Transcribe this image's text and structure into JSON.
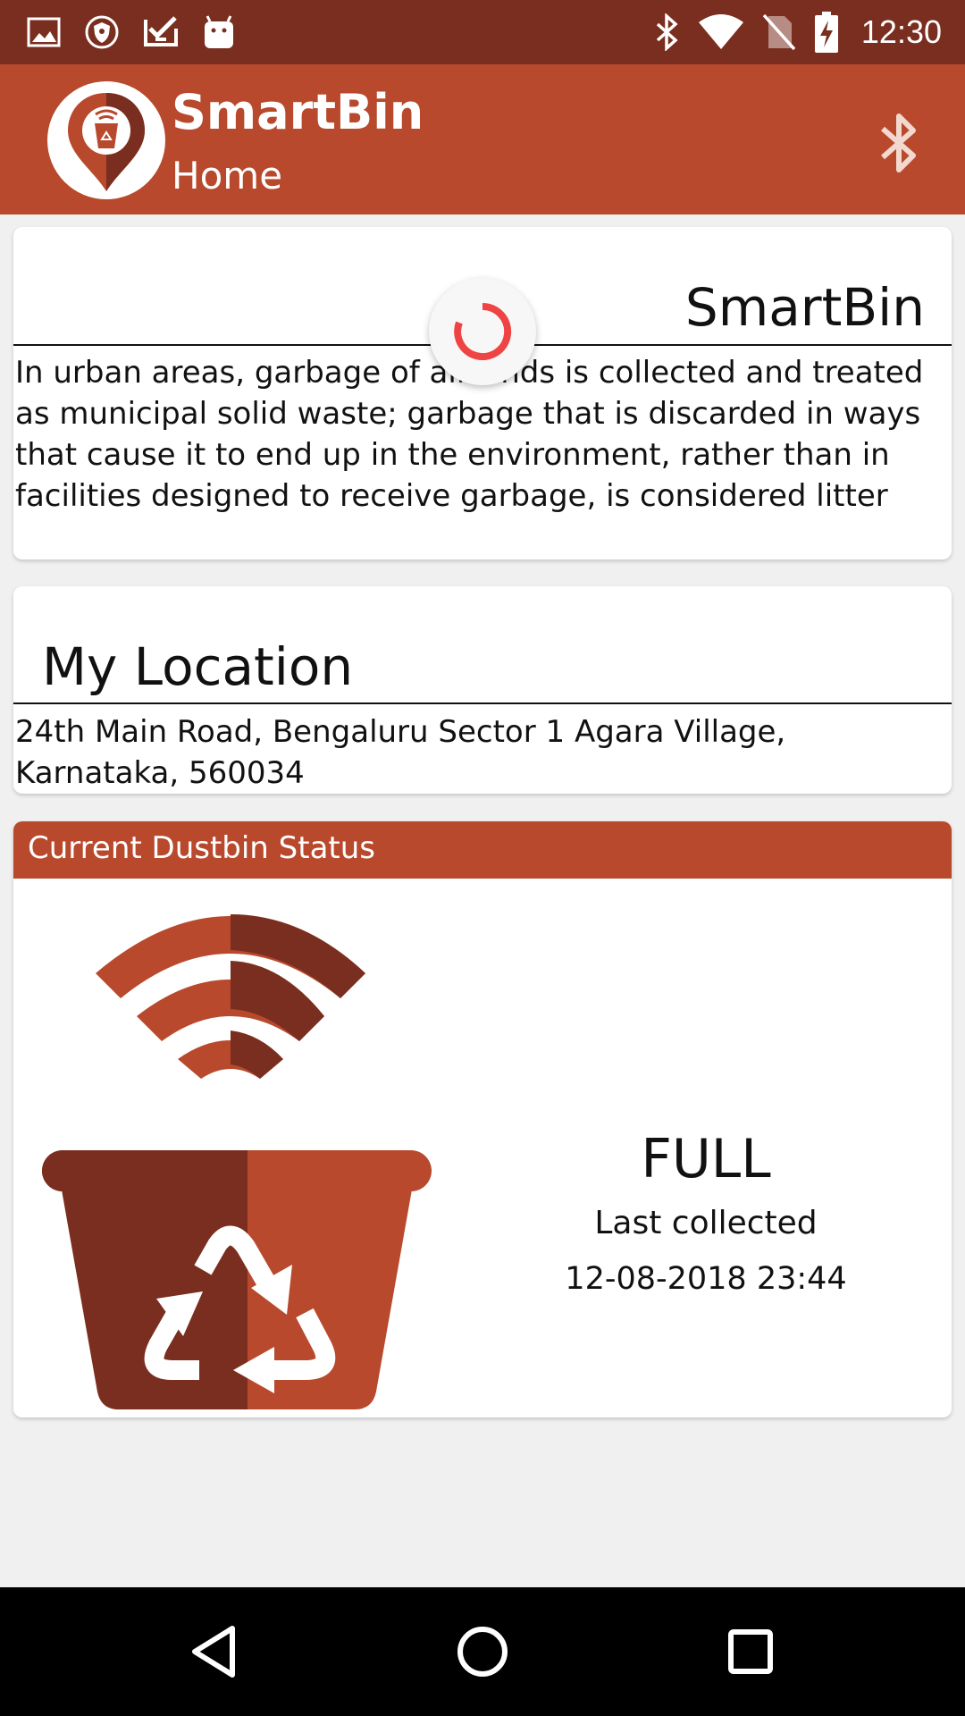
{
  "status_bar": {
    "time": "12:30",
    "left_icons": [
      "image-icon",
      "shield-icon",
      "checklist-icon",
      "android-icon"
    ],
    "right_icons": [
      "bluetooth-icon",
      "wifi-icon",
      "no-sim-icon",
      "battery-charging-icon"
    ]
  },
  "app_bar": {
    "title": "SmartBin",
    "subtitle": "Home",
    "logo_icon": "smartbin-location-pin-icon",
    "action_icon": "bluetooth-icon"
  },
  "about_card": {
    "title": "SmartBin",
    "body": "In urban areas, garbage of all kinds is collected and treated as municipal solid waste; garbage that is discarded in ways that cause it to end up in the environment, rather than in facilities designed to receive garbage, is considered litter"
  },
  "location_card": {
    "title": "My Location",
    "address": "24th Main Road, Bengaluru Sector 1 Agara Village, Karnataka, 560034"
  },
  "status_card": {
    "header": "Current Dustbin Status",
    "bin_icon": "smart-dustbin-recycle-icon",
    "status": "FULL",
    "last_collected_label": "Last collected",
    "last_collected_time": "12-08-2018 23:44"
  },
  "nav_bar": {
    "icons": [
      "back-triangle-icon",
      "home-circle-icon",
      "recents-square-icon"
    ]
  },
  "colors": {
    "status_bar": "#7a2e1f",
    "primary": "#b8492d",
    "primary_dark": "#7a2e1f",
    "spinner": "#ef4444",
    "background": "#f0f0f0"
  }
}
